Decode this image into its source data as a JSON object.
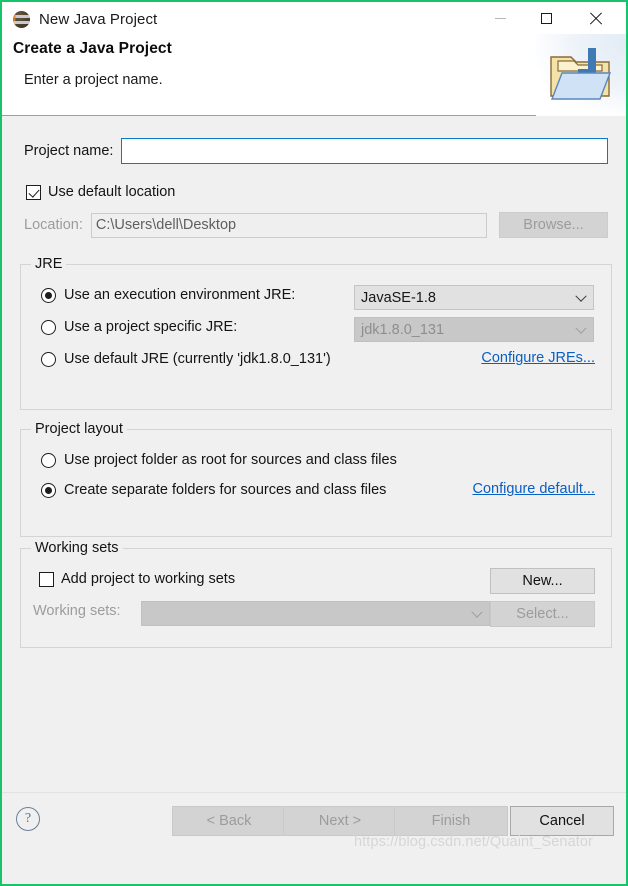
{
  "window": {
    "title": "New Java Project",
    "app_icon": "eclipse-icon",
    "border_color": "#18c46a",
    "controls": {
      "minimize": "minimize-icon",
      "maximize": "maximize-icon",
      "close": "close-icon"
    }
  },
  "header": {
    "title": "Create a Java Project",
    "description": "Enter a project name.",
    "banner_icon": "java-project-folder-icon"
  },
  "form": {
    "project_name": {
      "label": "Project name:",
      "value": "",
      "placeholder": ""
    },
    "use_default_location": {
      "label": "Use default location",
      "checked": true
    },
    "location": {
      "label": "Location:",
      "value": "C:\\Users\\dell\\Desktop",
      "enabled": false
    },
    "browse_button": {
      "label": "Browse...",
      "enabled": false
    }
  },
  "jre": {
    "group_title": "JRE",
    "options": [
      {
        "label": "Use an execution environment JRE:",
        "selected": true
      },
      {
        "label": "Use a project specific JRE:",
        "selected": false
      },
      {
        "label": "Use default JRE (currently 'jdk1.8.0_131')",
        "selected": false
      }
    ],
    "execution_env_combo": {
      "value": "JavaSE-1.8",
      "enabled": true
    },
    "specific_jre_combo": {
      "value": "jdk1.8.0_131",
      "enabled": false
    },
    "configure_link": "Configure JREs..."
  },
  "project_layout": {
    "group_title": "Project layout",
    "options": [
      {
        "label": "Use project folder as root for sources and class files",
        "selected": false
      },
      {
        "label": "Create separate folders for sources and class files",
        "selected": true
      }
    ],
    "configure_link": "Configure default..."
  },
  "working_sets": {
    "group_title": "Working sets",
    "add_checkbox": {
      "label": "Add project to working sets",
      "checked": false
    },
    "new_button": {
      "label": "New...",
      "enabled": true
    },
    "working_sets_label": "Working sets:",
    "working_sets_combo": {
      "value": "",
      "enabled": false
    },
    "select_button": {
      "label": "Select...",
      "enabled": false
    }
  },
  "footer": {
    "help_icon": "help-icon",
    "buttons": [
      {
        "label": "< Back",
        "enabled": false
      },
      {
        "label": "Next >",
        "enabled": false
      },
      {
        "label": "Finish",
        "enabled": false
      },
      {
        "label": "Cancel",
        "enabled": true
      }
    ],
    "watermark": "https://blog.csdn.net/Quaint_Senator"
  },
  "colors": {
    "accent_border": "#18c46a",
    "link": "#0a5fc4",
    "focus_border": "#0a79c8",
    "dialog_bg": "#f0f0f0"
  }
}
